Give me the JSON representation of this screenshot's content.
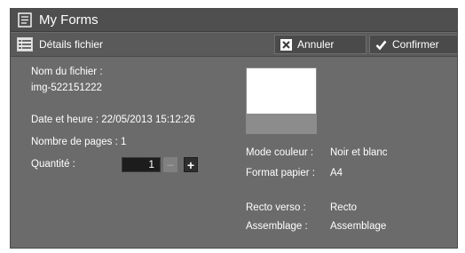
{
  "window": {
    "title": "My Forms"
  },
  "toolbar": {
    "section_title": "Détails fichier",
    "cancel_label": "Annuler",
    "confirm_label": "Confirmer"
  },
  "details": {
    "filename_label": "Nom du fichier :",
    "filename_value": "img-522151222",
    "datetime_text": "Date et heure : 22/05/2013 15:12:26",
    "pages_text": "Nombre de pages : 1",
    "quantity_label": "Quantité :",
    "quantity_value": "1"
  },
  "settings": {
    "color_mode_label": "Mode couleur :",
    "color_mode_value": "Noir et blanc",
    "paper_label": "Format papier :",
    "paper_value": "A4",
    "duplex_label": "Recto verso :",
    "duplex_value": "Recto",
    "collate_label": "Assemblage :",
    "collate_value": "Assemblage"
  },
  "icons": {
    "title": "forms-icon",
    "section": "list-icon",
    "cancel": "x-icon",
    "confirm": "checkmark-icon"
  },
  "colors": {
    "panel_bg": "#6b6b6b",
    "titlebar_bg": "#4f4f4f",
    "text": "#ffffff"
  }
}
